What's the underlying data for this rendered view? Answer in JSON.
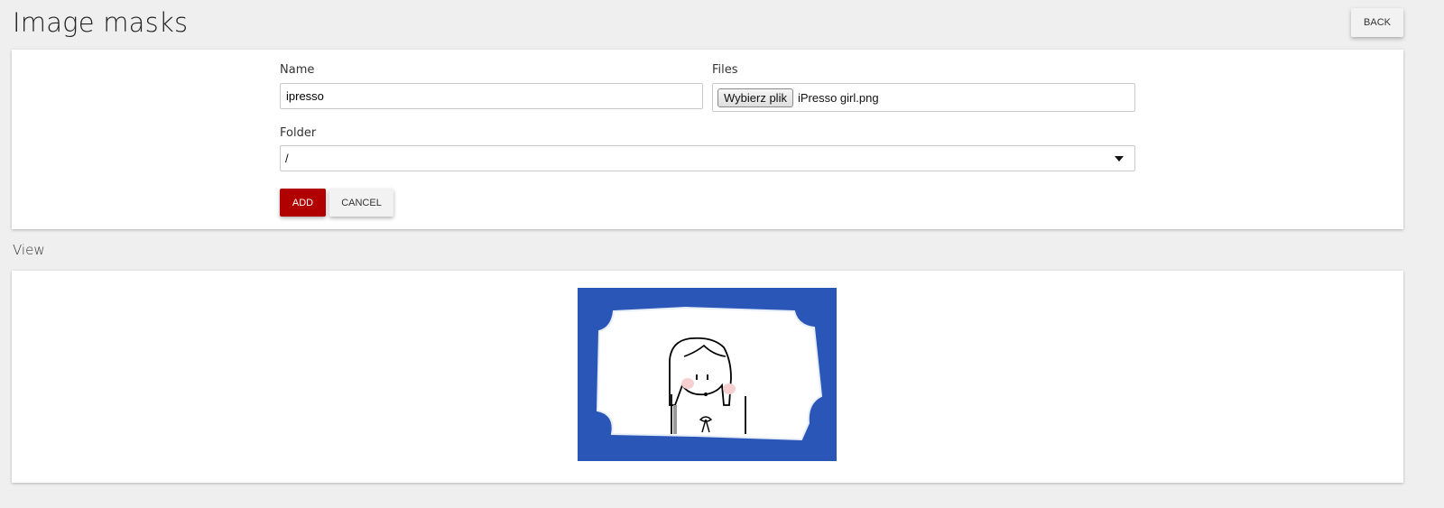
{
  "header": {
    "title": "Image masks",
    "back_label": "BACK"
  },
  "form": {
    "name_label": "Name",
    "name_value": "ipresso",
    "files_label": "Files",
    "file_button_label": "Wybierz plik",
    "file_name": "iPresso girl.png",
    "folder_label": "Folder",
    "folder_value": "/",
    "add_label": "ADD",
    "cancel_label": "CANCEL"
  },
  "view": {
    "title": "View"
  },
  "colors": {
    "accent": "#b00000",
    "mask_blue": "#2a56b8",
    "page_bg": "#efefef"
  }
}
